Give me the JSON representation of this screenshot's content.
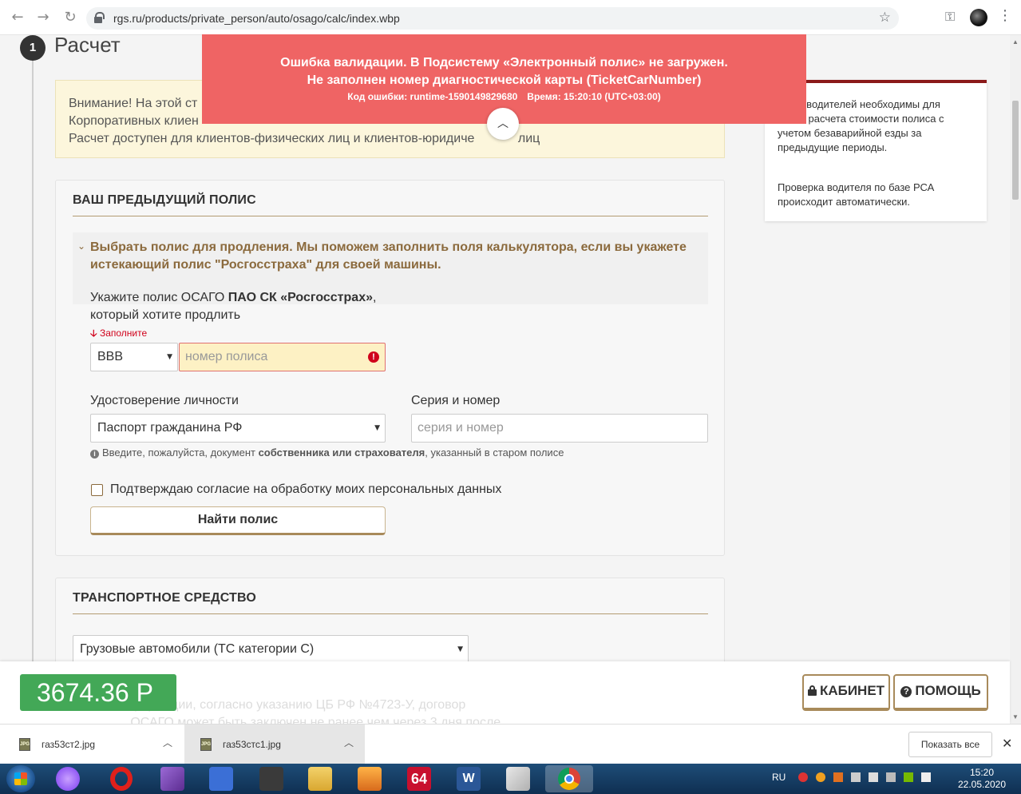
{
  "browser": {
    "url": "rgs.ru/products/private_person/auto/osago/calc/index.wbp"
  },
  "step": {
    "number": "1",
    "title": "Расчет"
  },
  "notice": {
    "line1": "Внимание! На этой ст",
    "line2": "Корпоративных клиен",
    "line3": "Расчет доступен для клиентов-физических лиц и клиентов-юридиче",
    "line3_end": "лиц"
  },
  "error_toast": {
    "line1": "Ошибка валидации. В Подсистему «Электронный полис» не загружен.",
    "line2": "Не заполнен номер диагностической карты (TicketCarNumber)",
    "code": "Код ошибки: runtime-1590149829680",
    "time": "Время: 15:20:10 (UTC+03:00)",
    "collapse_icon": "chevron-up-icon"
  },
  "side_card": {
    "text1": "…ые водителей необходимы для …ого расчета стоимости полиса с учетом безаварийной езды за предыдущие периоды.",
    "text1_a": "ые водителей необходимы для",
    "text1_b": "ого расчета стоимости полиса с",
    "text1_c": "учетом безаварийной езды за",
    "text1_d": "предыдущие периоды.",
    "text2_a": "Проверка водителя по базе РСА",
    "text2_b": "происходит автоматически."
  },
  "prev_policy": {
    "title": "ВАШ ПРЕДЫДУЩИЙ ПОЛИС",
    "expander": "Выбрать полис для продления. Мы поможем заполнить поля калькулятора, если вы укажете истекающий полис \"Росгосстраха\" для своей машины.",
    "policy_label_a": "Укажите полис ОСАГО ",
    "policy_label_bold": "ПАО СК «Росгосстрах»",
    "policy_label_b": ",",
    "policy_label_c": "который хотите продлить",
    "required": "Заполните",
    "series_value": "ВВВ",
    "number_placeholder": "номер полиса",
    "id_label": "Удостоверение личности",
    "id_value": "Паспорт гражданина РФ",
    "serial_label": "Серия и номер",
    "serial_placeholder": "серия и номер",
    "hint_a": "Введите, пожалуйста, документ ",
    "hint_bold": "собственника или страхователя",
    "hint_b": ", указанный в старом полисе",
    "consent": "Подтверждаю согласие на обработку моих персональных данных",
    "find_button": "Найти полис"
  },
  "vehicle": {
    "title": "ТРАНСПОРТНОЕ СРЕДСТВО",
    "type_value": "Грузовые автомобили (ТС категории С)"
  },
  "bottom_bar": {
    "price": "3674.36  Р",
    "ghost_line1": "...формации, согласно указанию ЦБ РФ №4723-У, договор",
    "ghost_line2": "...ОСАГО может быть заключен не ранее чем через 3 дня после...",
    "cabinet": "КАБИНЕТ",
    "help": "ПОМОЩЬ"
  },
  "downloads": {
    "file1": "газ53ст2.jpg",
    "file2": "газ53стс1.jpg",
    "show_all": "Показать все"
  },
  "taskbar": {
    "lang": "RU",
    "time": "15:20",
    "date": "22.05.2020"
  }
}
